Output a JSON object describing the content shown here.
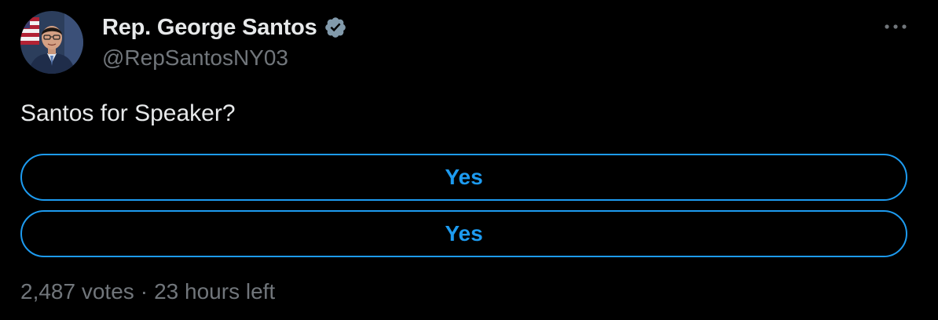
{
  "author": {
    "display_name": "Rep. George Santos",
    "handle": "@RepSantosNY03",
    "verified": true
  },
  "tweet": {
    "text": "Santos for Speaker?"
  },
  "poll": {
    "options": [
      {
        "label": "Yes"
      },
      {
        "label": "Yes"
      }
    ],
    "votes": "2,487 votes",
    "separator": "·",
    "time_left": "23 hours left"
  },
  "icons": {
    "verified": "verified-badge-icon",
    "more": "more-options-icon"
  },
  "colors": {
    "background": "#000000",
    "primary_text": "#e7e9ea",
    "secondary_text": "#71767b",
    "accent": "#1d9bf0",
    "badge": "#829aab"
  }
}
